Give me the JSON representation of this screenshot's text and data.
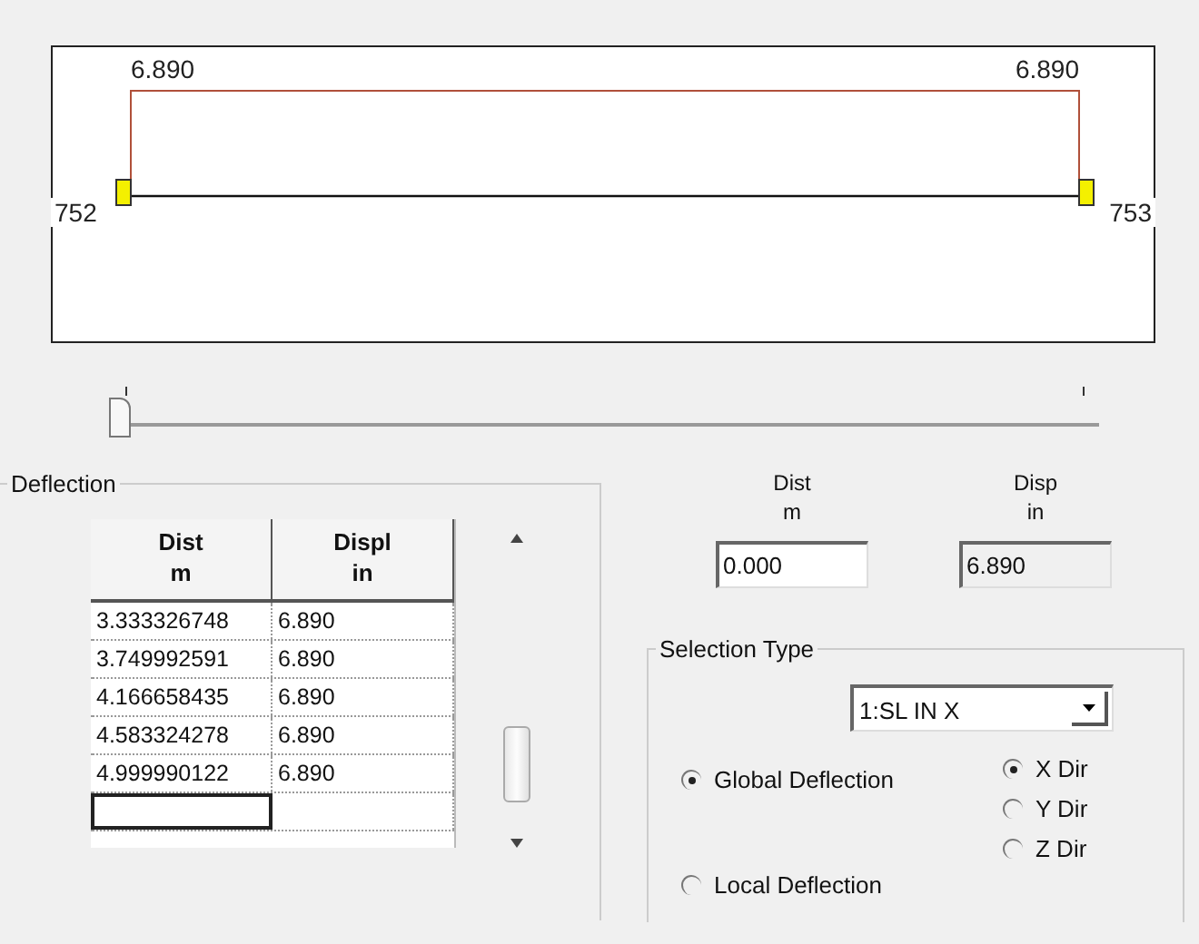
{
  "diagram": {
    "nodes": [
      {
        "label": "752"
      },
      {
        "label": "753"
      }
    ],
    "end_values": [
      "6.890",
      "6.890"
    ]
  },
  "slider": {
    "level": 0
  },
  "deflection": {
    "title": "Deflection",
    "columns": [
      {
        "name": "Dist",
        "unit": "m"
      },
      {
        "name": "Displ",
        "unit": "in"
      }
    ],
    "rows": [
      [
        "3.333326748",
        "6.890"
      ],
      [
        "3.749992591",
        "6.890"
      ],
      [
        "4.166658435",
        "6.890"
      ],
      [
        "4.583324278",
        "6.890"
      ],
      [
        "4.999990122",
        "6.890"
      ]
    ]
  },
  "readouts": [
    {
      "name": "Dist",
      "unit": "m",
      "value": "0.000",
      "disabled": false
    },
    {
      "name": "Disp",
      "unit": "in",
      "value": "6.890",
      "disabled": true
    }
  ],
  "selection_type": {
    "title": "Selection Type",
    "load_case": "1:SL IN X",
    "modes": [
      {
        "label": "Global Deflection",
        "selected": true
      },
      {
        "label": "Local Deflection",
        "selected": false
      }
    ],
    "directions": [
      {
        "label": "X Dir",
        "selected": true
      },
      {
        "label": "Y Dir",
        "selected": false
      },
      {
        "label": "Z Dir",
        "selected": false
      }
    ]
  }
}
